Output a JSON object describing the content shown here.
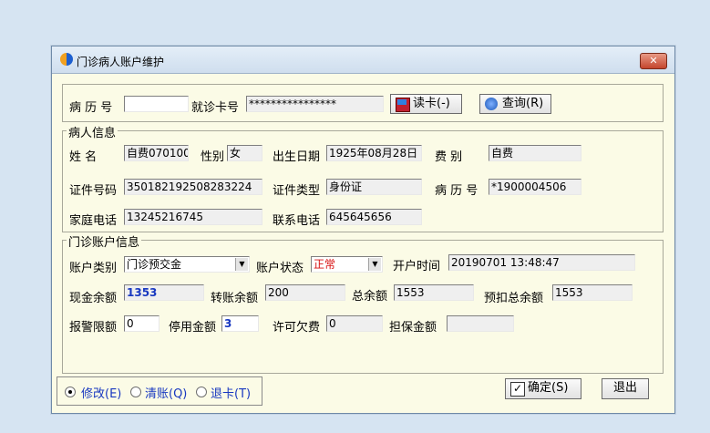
{
  "window": {
    "title": "门诊病人账户维护",
    "close": "✕"
  },
  "search": {
    "record_no_label": "病 历 号",
    "record_no_value": "",
    "card_no_label": "就诊卡号",
    "card_no_value": "****************",
    "read_card_label": "读卡(-)",
    "query_label": "查询(R)"
  },
  "patient": {
    "section_label": "病人信息",
    "name_label": "姓    名",
    "name_value": "自费070100",
    "gender_label": "性别",
    "gender_value": "女",
    "birth_label": "出生日期",
    "birth_value": "1925年08月28日",
    "fee_label": "费    别",
    "fee_value": "自费",
    "id_no_label": "证件号码",
    "id_no_value": "350182192508283224",
    "id_type_label": "证件类型",
    "id_type_value": "身份证",
    "record_no_label": "病 历 号",
    "record_no_value": "*1900004506",
    "home_phone_label": "家庭电话",
    "home_phone_value": "13245216745",
    "contact_phone_label": "联系电话",
    "contact_phone_value": "645645656"
  },
  "account": {
    "section_label": "门诊账户信息",
    "type_label": "账户类别",
    "type_value": "门诊预交金",
    "status_label": "账户状态",
    "status_value": "正常",
    "open_time_label": "开户时间",
    "open_time_value": "20190701 13:48:47",
    "cash_balance_label": "现金余额",
    "cash_balance_value": "1353",
    "transfer_balance_label": "转账余额",
    "transfer_balance_value": "200",
    "total_balance_label": "总余额",
    "total_balance_value": "1553",
    "prededuct_total_label": "预扣总余额",
    "prededuct_total_value": "1553",
    "alarm_limit_label": "报警限额",
    "alarm_limit_value": "0",
    "stop_amount_label": "停用金额",
    "stop_amount_value": "3",
    "allowed_debt_label": "许可欠费",
    "allowed_debt_value": "0",
    "guarantee_label": "担保金额",
    "guarantee_value": ""
  },
  "mode": {
    "modify_label": "修改(E)",
    "settle_label": "清账(Q)",
    "refund_label": "退卡(T)",
    "selected": "modify"
  },
  "actions": {
    "confirm_label": "确定(S)",
    "exit_label": "退出",
    "check_mark": "✓"
  },
  "icons": {
    "app": "app-logo-icon",
    "read_card": "card-reader-icon",
    "query": "search-icon",
    "confirm": "check-icon"
  }
}
